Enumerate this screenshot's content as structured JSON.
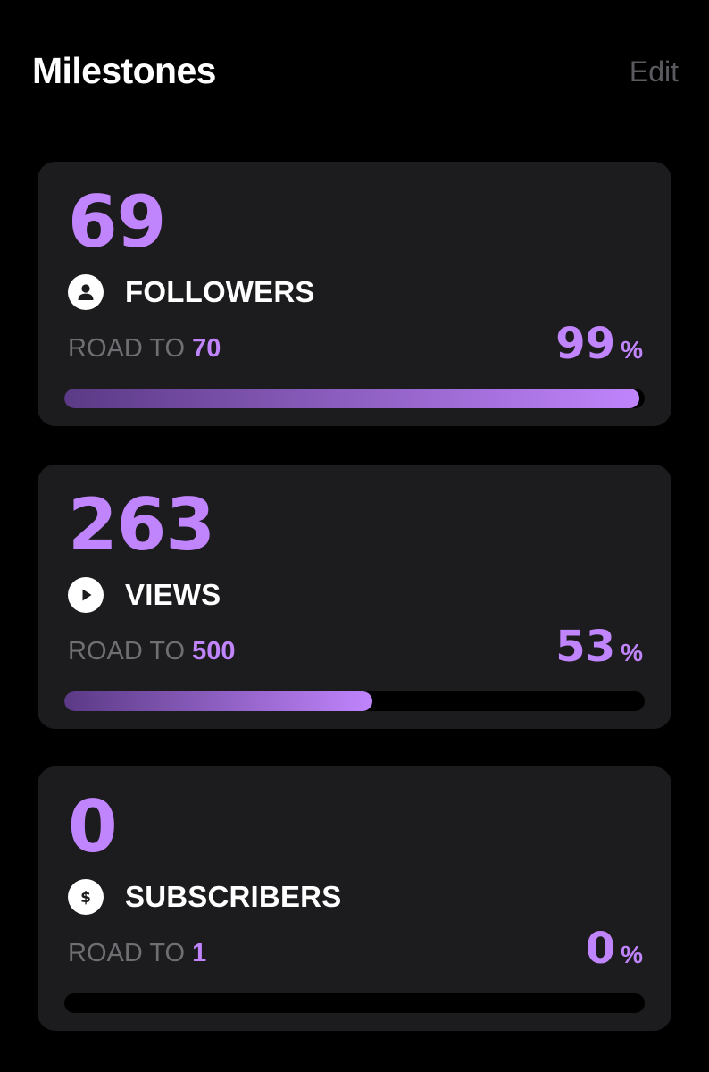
{
  "header": {
    "title": "Milestones",
    "edit_label": "Edit"
  },
  "colors": {
    "background": "#000000",
    "card": "#1c1c1e",
    "accent": "#c084fc",
    "muted_text": "#6e6e73"
  },
  "milestones": [
    {
      "value": "69",
      "icon": "person-icon",
      "label": "FOLLOWERS",
      "road_prefix": "ROAD TO",
      "road_target": "70",
      "percent": "99",
      "percent_sign": "%",
      "progress": 0.99
    },
    {
      "value": "263",
      "icon": "play-icon",
      "label": "VIEWS",
      "road_prefix": "ROAD TO",
      "road_target": "500",
      "percent": "53",
      "percent_sign": "%",
      "progress": 0.53
    },
    {
      "value": "0",
      "icon": "dollar-icon",
      "label": "SUBSCRIBERS",
      "road_prefix": "ROAD TO",
      "road_target": "1",
      "percent": "0",
      "percent_sign": "%",
      "progress": 0
    }
  ]
}
